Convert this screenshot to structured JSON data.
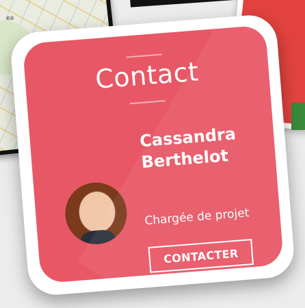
{
  "background": {
    "map_label": "ea"
  },
  "card": {
    "title": "Contact",
    "name_line1": "Cassandra",
    "name_line2": "Berthelot",
    "role": "Chargée de projet",
    "button_label": "CONTACTER",
    "accent_color": "#e85765",
    "avatar_icon": "person-photo"
  }
}
